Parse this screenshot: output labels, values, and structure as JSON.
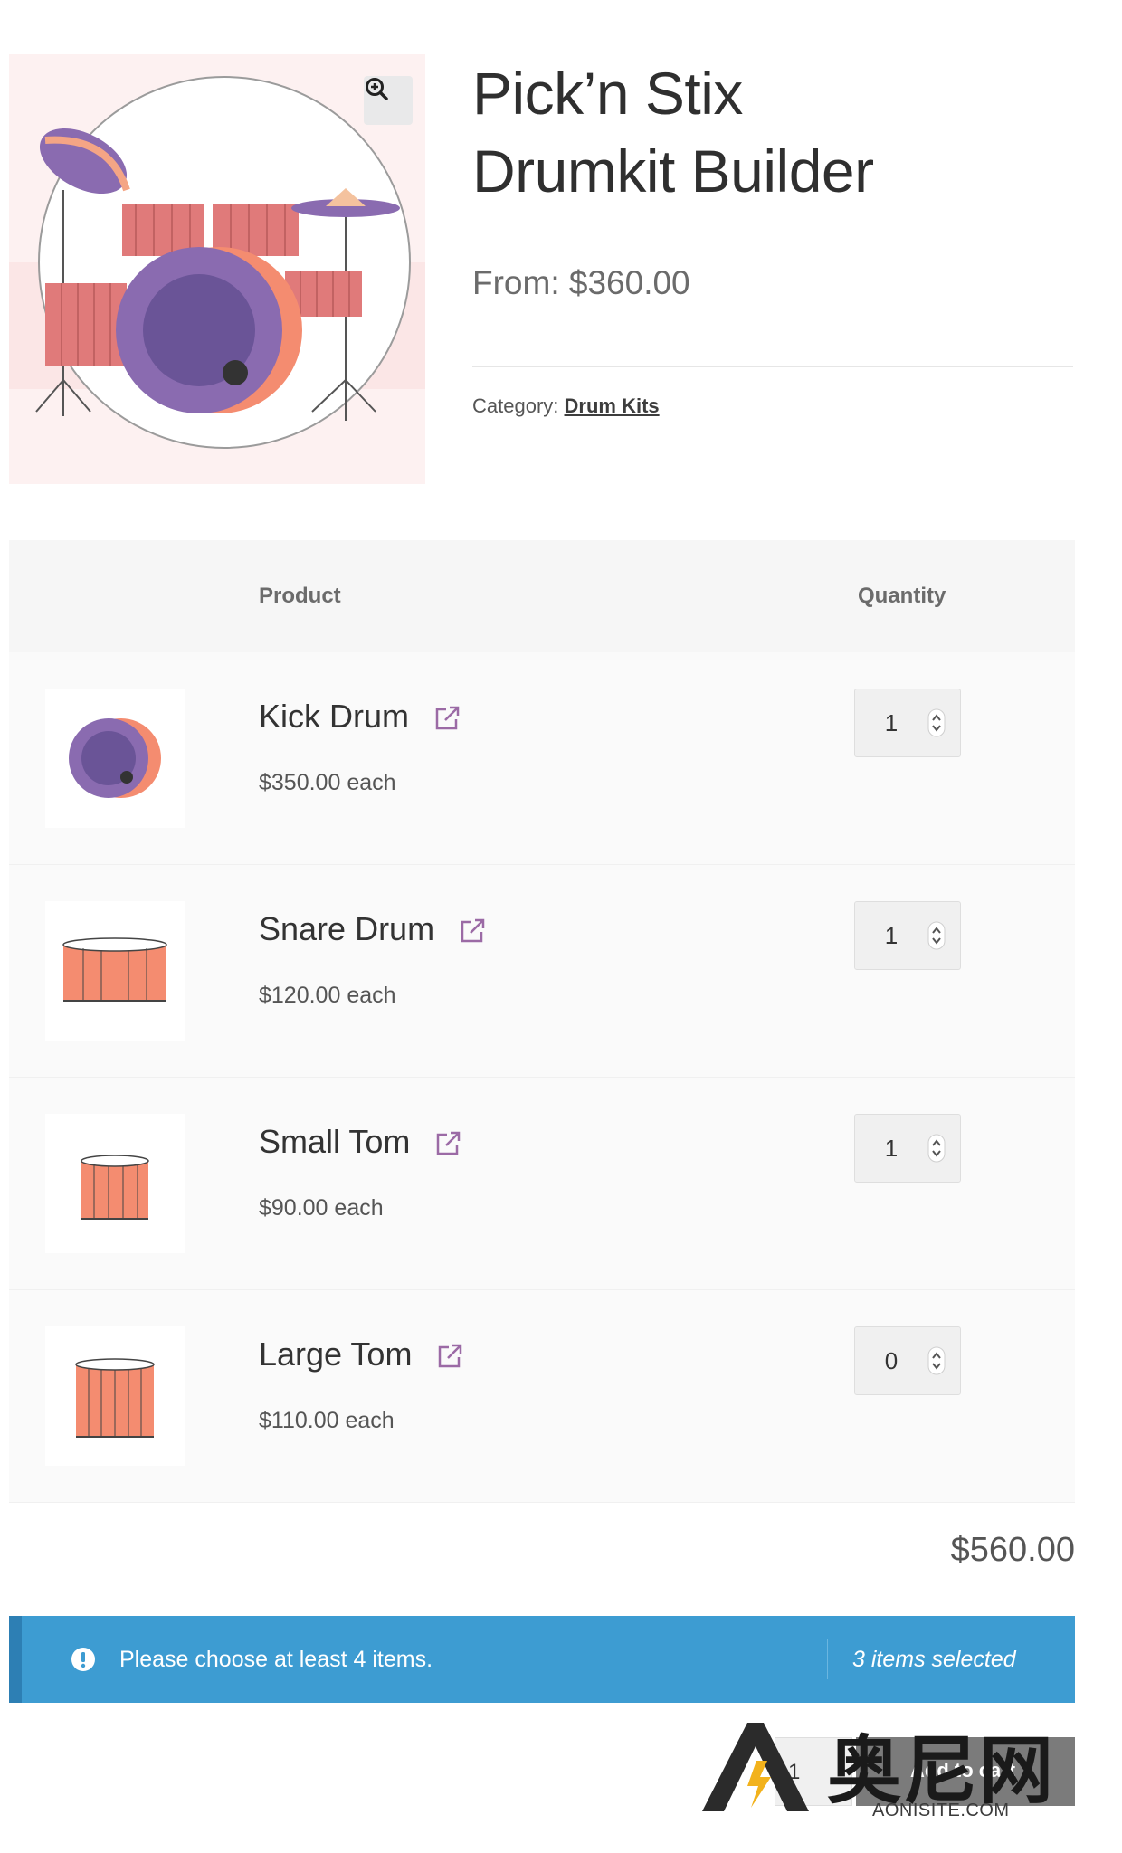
{
  "product": {
    "title_line1": "Pick’n Stix",
    "title_line2": "Drumkit Builder",
    "price_from": "From: $360.00",
    "category_label": "Category:",
    "category_link": "Drum Kits"
  },
  "table": {
    "header_product": "Product",
    "header_quantity": "Quantity",
    "rows": [
      {
        "name": "Kick Drum",
        "price": "$350.00 each",
        "qty": "1",
        "thumb": "kick-drum"
      },
      {
        "name": "Snare Drum",
        "price": "$120.00 each",
        "qty": "1",
        "thumb": "snare-drum"
      },
      {
        "name": "Small Tom",
        "price": "$90.00 each",
        "qty": "1",
        "thumb": "small-tom"
      },
      {
        "name": "Large Tom",
        "price": "$110.00 each",
        "qty": "0",
        "thumb": "large-tom"
      }
    ]
  },
  "total": "$560.00",
  "notice": {
    "message": "Please choose at least 4 items.",
    "count": "3 items selected",
    "icon": "exclamation-circle-icon"
  },
  "cart": {
    "qty": "1",
    "button_label": "Add to cart"
  },
  "watermark": {
    "cjk": "奥尼网",
    "url": "AONISITE.COM"
  },
  "colors": {
    "accent_purple": "#8a6bb0",
    "drum_orange": "#f48c70",
    "notice_blue": "#3d9cd2",
    "link_icon": "#9b6aa5"
  }
}
